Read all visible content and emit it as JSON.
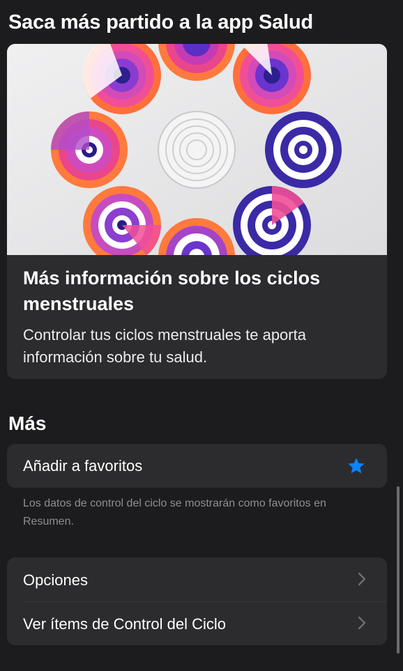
{
  "header": {
    "title": "Saca más partido a la app Salud"
  },
  "info_card": {
    "image_icon": "menstrual-cycle-rings-illustration",
    "title": "Más información sobre los ciclos menstruales",
    "description": "Controlar tus ciclos menstruales te aporta información sobre tu salud."
  },
  "more": {
    "title": "Más",
    "favorite_label": "Añadir a favoritos",
    "favorite_icon": "star-icon",
    "favorite_note": "Los datos de control del ciclo se mostrarán como favoritos en Resumen.",
    "rows": [
      {
        "label": "Opciones",
        "icon": "chevron-right-icon"
      },
      {
        "label": "Ver ítems de Control del Ciclo",
        "icon": "chevron-right-icon"
      }
    ]
  },
  "colors": {
    "background": "#1c1c1e",
    "card": "#2c2c2e",
    "accent": "#0a84ff",
    "secondary_text": "#8e8e93"
  }
}
